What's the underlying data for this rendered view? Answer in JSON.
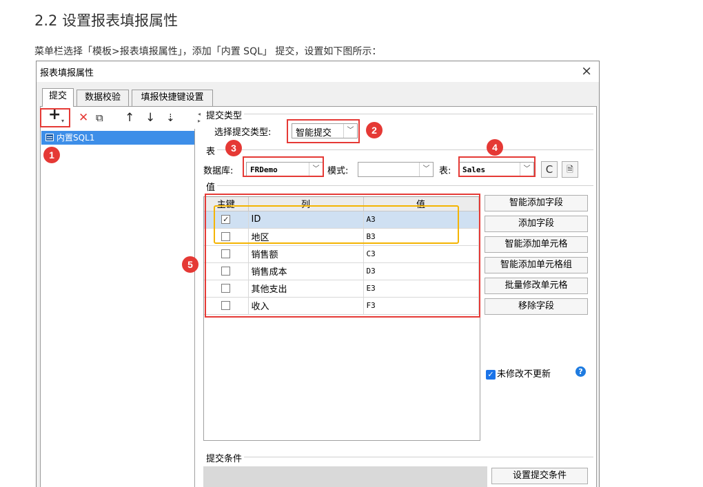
{
  "doc": {
    "title": "2.2 设置报表填报属性",
    "intro": "菜单栏选择「模板>报表填报属性」，添加「内置 SQL」 提交，设置如下图所示："
  },
  "dialog": {
    "title": "报表填报属性",
    "close": "×"
  },
  "tabs": [
    "提交",
    "数据校验",
    "填报快捷键设置"
  ],
  "toolbar": {
    "add": "+",
    "add_caret": "▾",
    "delete": "✕",
    "copy": "⧉",
    "up": "↑",
    "down": "↓",
    "sort": "⇣"
  },
  "list": {
    "items": [
      "内置SQL1"
    ]
  },
  "submit_type": {
    "group": "提交类型",
    "label": "选择提交类型:",
    "value": "智能提交"
  },
  "table_group": {
    "group": "表",
    "db_label": "数据库:",
    "db_value": "FRDemo",
    "schema_label": "模式:",
    "schema_value": "",
    "table_label": "表:",
    "table_value": "Sales",
    "refresh_icon": "C",
    "preview_icon": "🗎"
  },
  "value_group": {
    "group": "值",
    "columns": [
      "主键",
      "列",
      "值"
    ],
    "rows": [
      {
        "key": true,
        "column": "ID",
        "value": "A3",
        "selected": true
      },
      {
        "key": false,
        "column": "地区",
        "value": "B3",
        "selected": false
      },
      {
        "key": false,
        "column": "销售额",
        "value": "C3",
        "selected": false
      },
      {
        "key": false,
        "column": "销售成本",
        "value": "D3",
        "selected": false
      },
      {
        "key": false,
        "column": "其他支出",
        "value": "E3",
        "selected": false
      },
      {
        "key": false,
        "column": "收入",
        "value": "F3",
        "selected": false
      }
    ]
  },
  "side_buttons": [
    "智能添加字段",
    "添加字段",
    "智能添加单元格",
    "智能添加单元格组",
    "批量修改单元格",
    "移除字段"
  ],
  "unmodified": {
    "label": "未修改不更新",
    "checked": true,
    "help": "?"
  },
  "condition": {
    "group": "提交条件",
    "button": "设置提交条件"
  },
  "annotations": [
    "1",
    "2",
    "3",
    "4",
    "5"
  ],
  "colors": {
    "highlight_red": "#e53935",
    "highlight_yellow": "#f4b400",
    "selection_blue": "#3d8ee8"
  }
}
